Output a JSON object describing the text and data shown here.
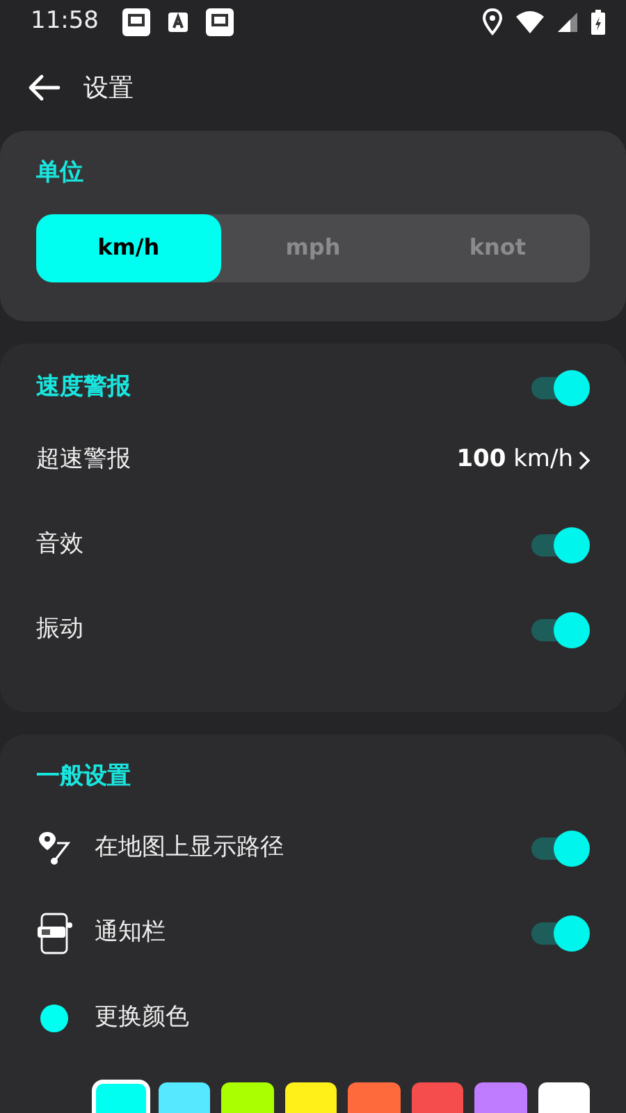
{
  "status_bar": {
    "time": "11:58"
  },
  "header": {
    "title": "设置"
  },
  "units": {
    "title": "单位",
    "options": [
      {
        "label": "km/h",
        "selected": true
      },
      {
        "label": "mph",
        "selected": false
      },
      {
        "label": "knot",
        "selected": false
      }
    ]
  },
  "speed_alert": {
    "title": "速度警报",
    "on": true,
    "rows": [
      {
        "kind": "value",
        "label": "超速警报",
        "value": "**100** km/h"
      },
      {
        "kind": "toggle",
        "label": "音效",
        "on": true
      },
      {
        "kind": "toggle",
        "label": "振动",
        "on": true
      }
    ]
  },
  "general": {
    "title": "一般设置",
    "rows": [
      {
        "kind": "toggle",
        "label": "在地图上显示路径",
        "on": true
      },
      {
        "kind": "toggle",
        "label": "通知栏",
        "on": true
      },
      {
        "kind": "color",
        "label": "更换颜色",
        "color": "#00fff0"
      }
    ],
    "swatches": [
      {
        "color": "#00fff0",
        "selected": true
      },
      {
        "color": "#55e8ff",
        "selected": false
      },
      {
        "color": "#aaff00",
        "selected": false
      },
      {
        "color": "#fff01a",
        "selected": false
      },
      {
        "color": "#ff6a3d",
        "selected": false
      },
      {
        "color": "#f54d4d",
        "selected": false
      },
      {
        "color": "#c07cff",
        "selected": false
      },
      {
        "color": "#ffffff",
        "selected": false
      }
    ]
  }
}
